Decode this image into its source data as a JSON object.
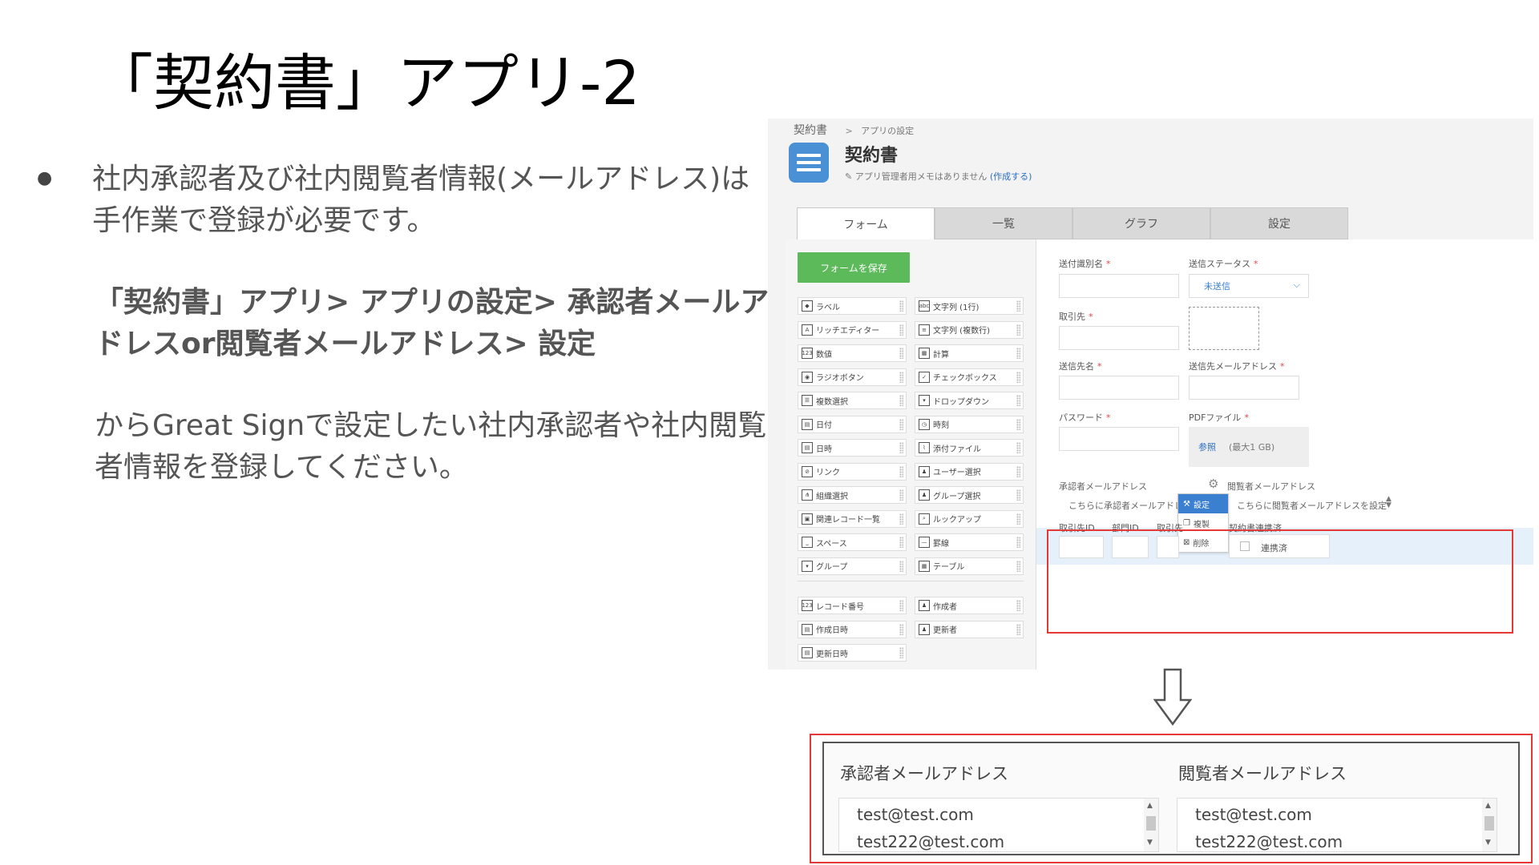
{
  "slide": {
    "title": "「契約書」アプリ-2",
    "bullet": "●",
    "para1": "社内承認者及び社内閲覧者情報(メールアドレス)は手作業で登録が必要です。",
    "para2": "「契約書」アプリ> アプリの設定> 承認者メールアドレスor閲覧者メールアドレス> 設定",
    "para3": "からGreat Signで設定したい社内承認者や社内閲覧者情報を登録してください。"
  },
  "app": {
    "breadcrumb_root": "契約書",
    "breadcrumb_sep": ">",
    "breadcrumb_sub": "アプリの設定",
    "name": "契約書",
    "memo_text": "アプリ管理者用メモはありません",
    "memo_link": "(作成する)",
    "tabs": [
      "フォーム",
      "一覧",
      "グラフ",
      "設定"
    ],
    "save_button": "フォームを保存",
    "palette": [
      {
        "label": "ラベル",
        "icon": "label-icon",
        "glyph": "◆"
      },
      {
        "label": "文字列 (1行)",
        "icon": "text-single-icon",
        "glyph": "abc"
      },
      {
        "label": "リッチエディター",
        "icon": "rich-editor-icon",
        "glyph": "A"
      },
      {
        "label": "文字列 (複数行)",
        "icon": "text-multi-icon",
        "glyph": "≡"
      },
      {
        "label": "数値",
        "icon": "number-icon",
        "glyph": "123"
      },
      {
        "label": "計算",
        "icon": "calc-icon",
        "glyph": "▦"
      },
      {
        "label": "ラジオボタン",
        "icon": "radio-icon",
        "glyph": "◉"
      },
      {
        "label": "チェックボックス",
        "icon": "checkbox-icon",
        "glyph": "✓"
      },
      {
        "label": "複数選択",
        "icon": "multi-select-icon",
        "glyph": "☰"
      },
      {
        "label": "ドロップダウン",
        "icon": "dropdown-icon",
        "glyph": "▾"
      },
      {
        "label": "日付",
        "icon": "date-icon",
        "glyph": "▤"
      },
      {
        "label": "時刻",
        "icon": "time-icon",
        "glyph": "◷"
      },
      {
        "label": "日時",
        "icon": "datetime-icon",
        "glyph": "▤"
      },
      {
        "label": "添付ファイル",
        "icon": "attachment-icon",
        "glyph": "⌇"
      },
      {
        "label": "リンク",
        "icon": "link-icon",
        "glyph": "⊘"
      },
      {
        "label": "ユーザー選択",
        "icon": "user-select-icon",
        "glyph": "♟"
      },
      {
        "label": "組織選択",
        "icon": "org-select-icon",
        "glyph": "⋔"
      },
      {
        "label": "グループ選択",
        "icon": "group-select-icon",
        "glyph": "♟"
      },
      {
        "label": "関連レコード一覧",
        "icon": "related-records-icon",
        "glyph": "▣"
      },
      {
        "label": "ルックアップ",
        "icon": "lookup-icon",
        "glyph": "⌕"
      },
      {
        "label": "スペース",
        "icon": "space-icon",
        "glyph": "⎵"
      },
      {
        "label": "罫線",
        "icon": "border-icon",
        "glyph": "—"
      },
      {
        "label": "グループ",
        "icon": "group-icon",
        "glyph": "▾"
      },
      {
        "label": "テーブル",
        "icon": "table-icon",
        "glyph": "▦"
      }
    ],
    "palette_system": [
      {
        "label": "レコード番号",
        "icon": "record-number-icon",
        "glyph": "123"
      },
      {
        "label": "作成者",
        "icon": "creator-icon",
        "glyph": "♟"
      },
      {
        "label": "作成日時",
        "icon": "created-datetime-icon",
        "glyph": "▤"
      },
      {
        "label": "更新者",
        "icon": "updater-icon",
        "glyph": "♟"
      },
      {
        "label": "更新日時",
        "icon": "updated-datetime-icon",
        "glyph": "▤"
      }
    ],
    "fields": {
      "send_id_label": "送付識別名",
      "send_status_label": "送信ステータス",
      "send_status_value": "未送信",
      "customer_label": "取引先",
      "recipient_name_label": "送信先名",
      "recipient_email_label": "送信先メールアドレス",
      "password_label": "パスワード",
      "pdf_label": "PDFファイル",
      "pdf_browse": "参照",
      "pdf_max": "(最大1 GB)",
      "required_mark": "*",
      "approver_email_label": "承認者メールアドレス",
      "approver_email_placeholder": "こちらに承認者メールアドレスを設定",
      "viewer_email_label": "閲覧者メールアドレス",
      "viewer_email_placeholder": "こちらに閲覧者メールアドレスを設定",
      "customer_id_label": "取引先ID",
      "dept_id_label": "部門ID",
      "customer_short_label": "取引先",
      "contract_link_label": "契約書連携済",
      "contract_link_option": "連携済"
    },
    "context_menu": [
      "設定",
      "複製",
      "削除"
    ]
  },
  "result": {
    "approver_label": "承認者メールアドレス",
    "viewer_label": "閲覧者メールアドレス",
    "approver_emails": [
      "test@test.com",
      "test222@test.com"
    ],
    "viewer_emails": [
      "test@test.com",
      "test222@test.com"
    ]
  },
  "colors": {
    "accent": "#3a7fd0",
    "save_button": "#5dba5a",
    "highlight_border": "#e53935",
    "required": "#e0454a"
  }
}
